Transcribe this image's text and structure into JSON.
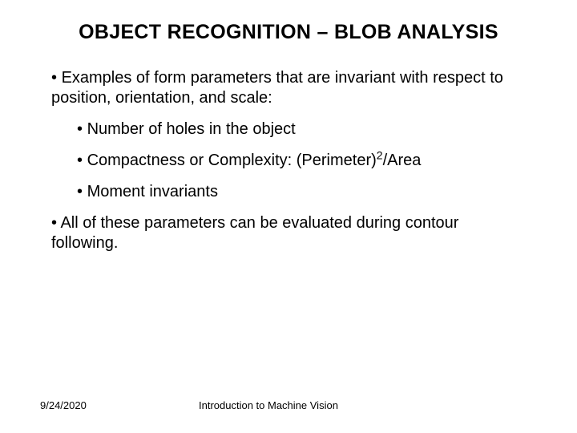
{
  "title": "OBJECT RECOGNITION – BLOB ANALYSIS",
  "p1": "Examples of form parameters that are invariant with respect to position, orientation, and scale:",
  "b1": "Number of holes in the object",
  "b2_pre": "Compactness or Complexity: (Perimeter)",
  "b2_sup": "2",
  "b2_post": "/Area",
  "b3": "Moment invariants",
  "p2": "All of these parameters can be evaluated during contour following.",
  "footer": {
    "date": "9/24/2020",
    "title": "Introduction to Machine Vision"
  }
}
